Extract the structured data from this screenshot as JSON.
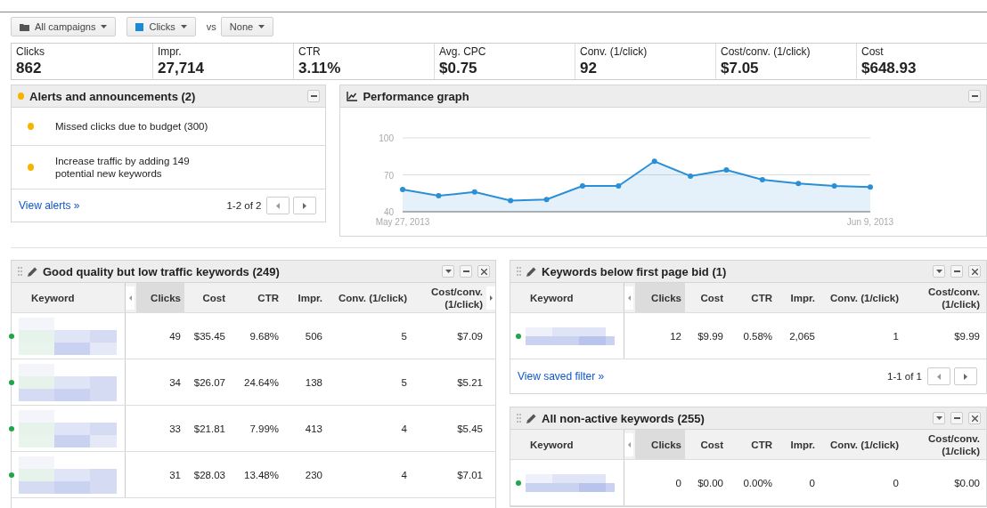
{
  "toolbar": {
    "campaign_filter": "All campaigns",
    "metric_filter": "Clicks",
    "vs_label": "vs",
    "compare_filter": "None"
  },
  "metrics": [
    {
      "label": "Clicks",
      "value": "862"
    },
    {
      "label": "Impr.",
      "value": "27,714"
    },
    {
      "label": "CTR",
      "value": "3.11%"
    },
    {
      "label": "Avg. CPC",
      "value": "$0.75"
    },
    {
      "label": "Conv. (1/click)",
      "value": "92"
    },
    {
      "label": "Cost/conv. (1/click)",
      "value": "$7.05"
    },
    {
      "label": "Cost",
      "value": "$648.93"
    }
  ],
  "alerts": {
    "title": "Alerts and announcements (2)",
    "items": [
      {
        "text": "Missed clicks due to budget (300)"
      },
      {
        "text": "Increase traffic by adding 149 potential new keywords"
      }
    ],
    "link": "View alerts »",
    "pager": "1-2 of 2"
  },
  "performance_graph": {
    "title": "Performance graph",
    "chart_data": {
      "type": "area",
      "categories": [
        "May 27, 2013",
        null,
        null,
        null,
        null,
        null,
        null,
        null,
        null,
        null,
        null,
        null,
        null,
        "Jun 9, 2013"
      ],
      "series": [
        {
          "color": "#2b8fd6",
          "values": [
            58,
            53,
            56,
            49,
            50,
            61,
            61,
            81,
            69,
            74,
            66,
            63,
            61,
            60
          ]
        }
      ],
      "ylim": [
        40,
        100
      ],
      "yticks": [
        40,
        70,
        100
      ]
    }
  },
  "keyword_tables": [
    {
      "title": "Good quality but low traffic keywords (249)",
      "columns": [
        {
          "label": "Keyword",
          "selected": false
        },
        {
          "label": "Clicks",
          "selected": true
        },
        {
          "label": "Cost",
          "selected": false
        },
        {
          "label": "CTR",
          "selected": false
        },
        {
          "label": "Impr.",
          "selected": false
        },
        {
          "label": "Conv. (1/click)",
          "selected": false
        },
        {
          "label": "Cost/conv. (1/click)",
          "selected": false
        }
      ],
      "rows": [
        {
          "cells": [
            "",
            "49",
            "$35.45",
            "9.68%",
            "506",
            "5",
            "$7.09"
          ]
        },
        {
          "cells": [
            "",
            "34",
            "$26.07",
            "24.64%",
            "138",
            "5",
            "$5.21"
          ]
        },
        {
          "cells": [
            "",
            "33",
            "$21.81",
            "7.99%",
            "413",
            "4",
            "$5.45"
          ]
        },
        {
          "cells": [
            "",
            "31",
            "$28.03",
            "13.48%",
            "230",
            "4",
            "$7.01"
          ]
        }
      ]
    },
    {
      "title": "Keywords below first page bid (1)",
      "columns": [
        {
          "label": "Keyword",
          "selected": false
        },
        {
          "label": "Clicks",
          "selected": true
        },
        {
          "label": "Cost",
          "selected": false
        },
        {
          "label": "CTR",
          "selected": false
        },
        {
          "label": "Impr.",
          "selected": false
        },
        {
          "label": "Conv. (1/click)",
          "selected": false
        },
        {
          "label": "Cost/conv. (1/click)",
          "selected": false
        }
      ],
      "rows": [
        {
          "cells": [
            "",
            "12",
            "$9.99",
            "0.58%",
            "2,065",
            "1",
            "$9.99"
          ]
        }
      ],
      "link": "View saved filter »",
      "pager": "1-1 of 1"
    },
    {
      "title": "All non-active keywords (255)",
      "columns": [
        {
          "label": "Keyword",
          "selected": false
        },
        {
          "label": "Clicks",
          "selected": true
        },
        {
          "label": "Cost",
          "selected": false
        },
        {
          "label": "CTR",
          "selected": false
        },
        {
          "label": "Impr.",
          "selected": false
        },
        {
          "label": "Conv. (1/click)",
          "selected": false
        },
        {
          "label": "Cost/conv. (1/click)",
          "selected": false
        }
      ],
      "rows": [
        {
          "cells": [
            "",
            "0",
            "$0.00",
            "0.00%",
            "0",
            "0",
            "$0.00"
          ]
        }
      ]
    }
  ]
}
